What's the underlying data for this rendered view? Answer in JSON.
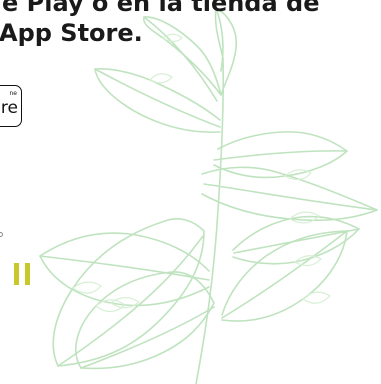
{
  "header": {
    "line1": "e Play o en la tienda de",
    "line2": "App Store."
  },
  "store_badge": {
    "small_text": "ne",
    "main_text": "re"
  },
  "colors": {
    "heading": "#1a1a1a",
    "plant_stroke": "#bfe3bf",
    "plant_stroke_light": "#d7efd5",
    "pause_accent": "#c9c82a"
  },
  "icons": {
    "pause": "pause-icon",
    "circle": "small-circle-icon",
    "plant": "plant-illustration"
  }
}
